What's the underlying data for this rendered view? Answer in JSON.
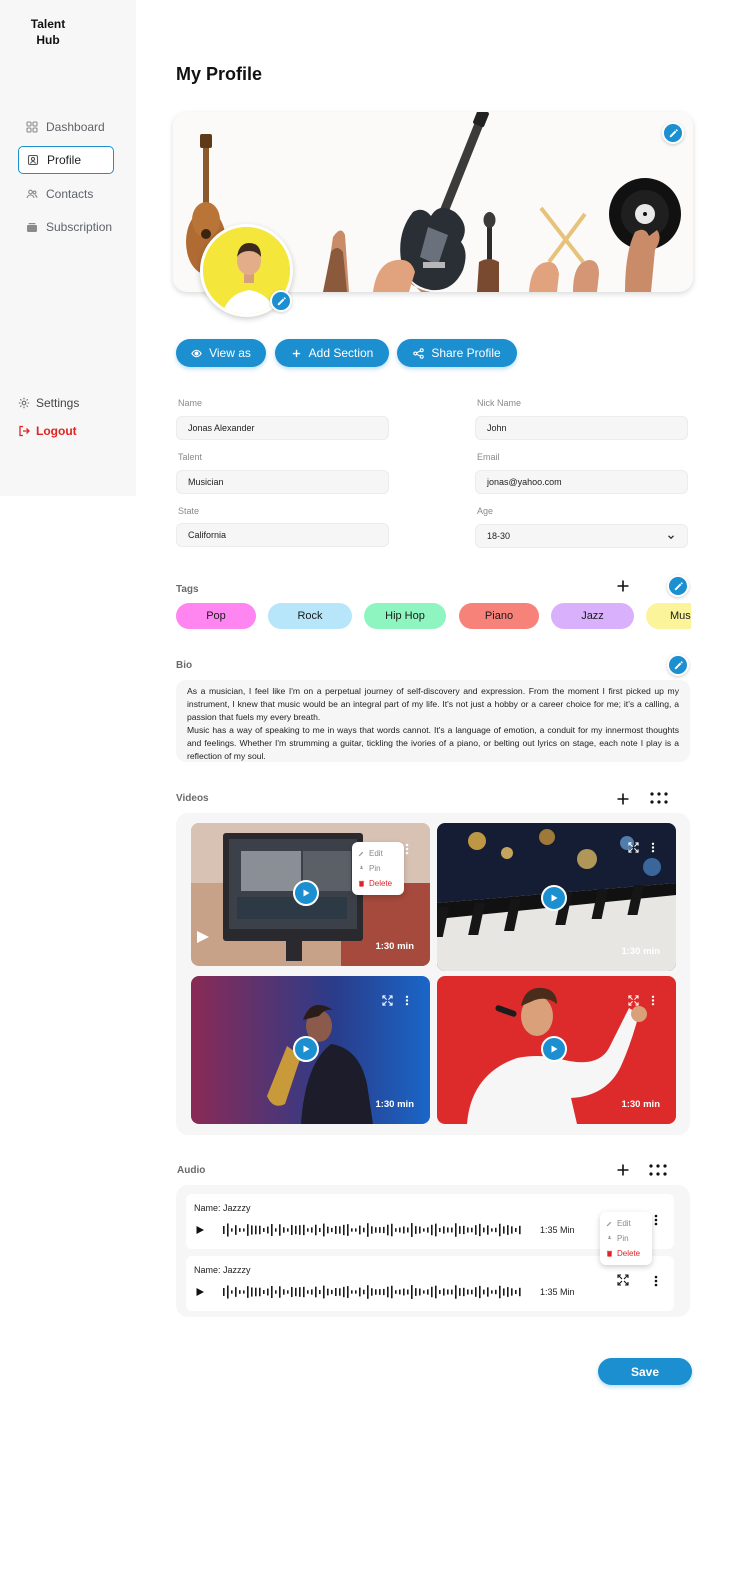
{
  "brand": {
    "logo_line1": "Talent",
    "logo_line2": "Hub"
  },
  "sidebar": {
    "items": [
      {
        "label": "Dashboard",
        "icon": "dashboard-icon"
      },
      {
        "label": "Profile",
        "icon": "profile-icon",
        "active": true
      },
      {
        "label": "Contacts",
        "icon": "contacts-icon"
      },
      {
        "label": "Subscription",
        "icon": "subscription-icon"
      }
    ],
    "settings_label": "Settings",
    "logout_label": "Logout"
  },
  "page": {
    "title": "My Profile"
  },
  "actions": {
    "view_as": "View as",
    "add_section": "Add Section",
    "share_profile": "Share Profile"
  },
  "form": {
    "name_label": "Name",
    "name_value": "Jonas Alexander",
    "nick_label": "Nick Name",
    "nick_value": "John",
    "talent_label": "Talent",
    "talent_value": "Musician",
    "email_label": "Email",
    "email_value": "jonas@yahoo.com",
    "state_label": "State",
    "state_value": "California",
    "age_label": "Age",
    "age_value": "18-30"
  },
  "tags": {
    "title": "Tags",
    "items": [
      {
        "label": "Pop",
        "color": "#ff86f0"
      },
      {
        "label": "Rock",
        "color": "#b7e6fb"
      },
      {
        "label": "Hip Hop",
        "color": "#8ff5c0"
      },
      {
        "label": "Piano",
        "color": "#f7827a"
      },
      {
        "label": "Jazz",
        "color": "#d9b0fb"
      },
      {
        "label": "Music",
        "color": "#fbf49a"
      }
    ]
  },
  "bio": {
    "title": "Bio",
    "paragraph1": "As a musician, I feel like I'm on a perpetual journey of self-discovery and expression. From the moment I first picked up my instrument, I knew that music would be an integral part of my life. It's not just a hobby or a career choice for me; it's a calling, a passion that fuels my every breath.",
    "paragraph2": "Music has a way of speaking to me in ways that words cannot. It's a language of emotion, a conduit for my innermost thoughts and feelings. Whether I'm strumming a guitar, tickling the ivories of a piano, or belting out lyrics on stage, each note I play is a reflection of my soul."
  },
  "videos": {
    "title": "Videos",
    "items": [
      {
        "duration": "1:30 min"
      },
      {
        "duration": "1:30 min"
      },
      {
        "duration": "1:30 min"
      },
      {
        "duration": "1:30 min"
      }
    ],
    "menu": {
      "edit": "Edit",
      "pin": "Pin",
      "delete": "Delete"
    }
  },
  "audio": {
    "title": "Audio",
    "tracks": [
      {
        "name": "Name: Jazzzy",
        "duration": "1:35 Min"
      },
      {
        "name": "Name: Jazzzy",
        "duration": "1:35 Min"
      }
    ],
    "menu": {
      "edit": "Edit",
      "pin": "Pin",
      "delete": "Delete"
    }
  },
  "save_label": "Save",
  "colors": {
    "accent": "#1b8fd0",
    "danger": "#e02424"
  }
}
